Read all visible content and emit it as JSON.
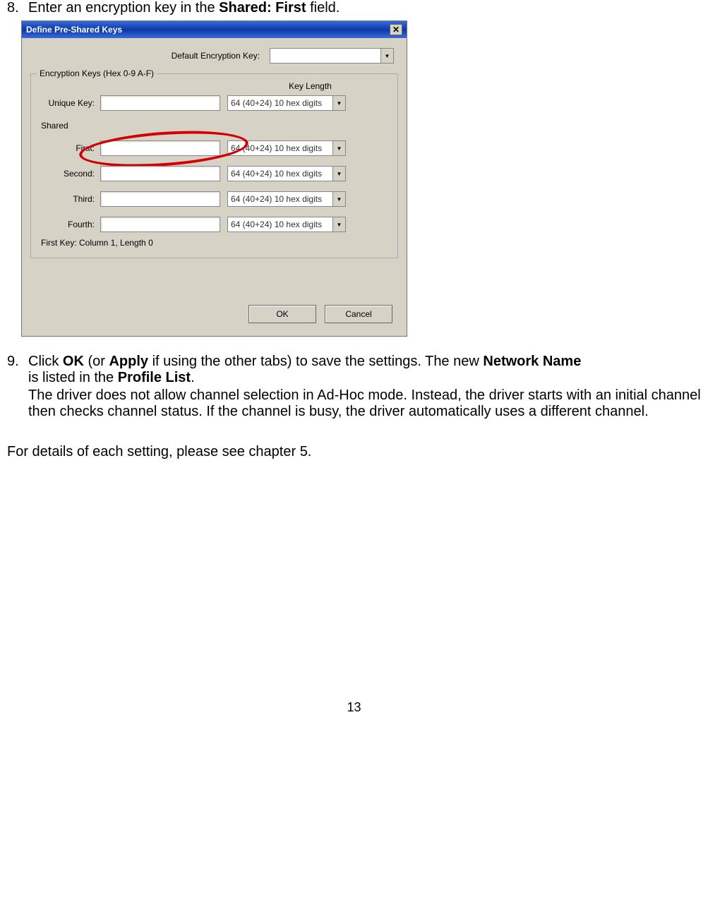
{
  "step8": {
    "num": "8.",
    "text_pre": "Enter an encryption key in the ",
    "bold": "Shared: First",
    "text_post": " field."
  },
  "dialog": {
    "title": "Define Pre-Shared Keys",
    "default_key_label": "Default Encryption Key:",
    "fieldset_legend": "Encryption Keys (Hex 0-9 A-F)",
    "key_length_header": "Key Length",
    "unique_label": "Unique Key:",
    "sel_option": "64  (40+24)  10 hex digits",
    "shared_label": "Shared",
    "first_label": "First:",
    "second_label": "Second:",
    "third_label": "Third:",
    "fourth_label": "Fourth:",
    "status": "First Key: Column 1,  Length 0",
    "ok": "OK",
    "cancel": "Cancel"
  },
  "step9": {
    "num": "9.",
    "line1_pre": "Click ",
    "b1": "OK",
    "line1_mid1": " (or ",
    "b2": "Apply",
    "line1_mid2": " if using the other tabs) to save the settings. The new ",
    "b3": "Network Name",
    "line2_pre": "is listed in the ",
    "b4": "Profile List",
    "line2_post": ".",
    "para2": "The driver does not allow channel selection in Ad-Hoc mode. Instead, the driver starts with an initial channel then checks channel status. If the channel is busy, the driver automatically uses a different channel."
  },
  "details": "For details of each setting, please see chapter 5.",
  "page": "13"
}
